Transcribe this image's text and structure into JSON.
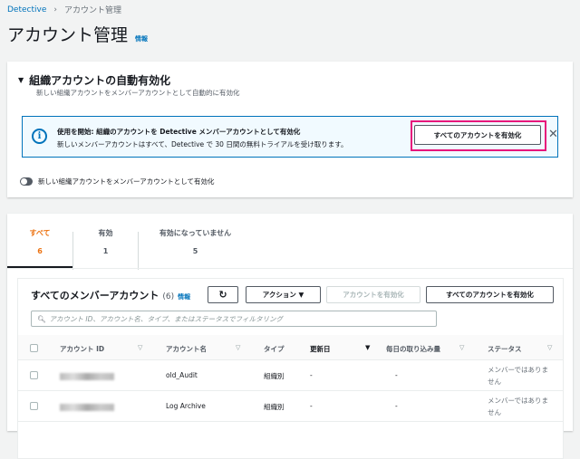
{
  "breadcrumb": {
    "root": "Detective",
    "current": "アカウント管理"
  },
  "page": {
    "title": "アカウント管理",
    "info": "情報"
  },
  "auto_enable": {
    "title": "組織アカウントの自動有効化",
    "subtitle": "新しい組織アカウントをメンバーアカウントとして自動的に有効化",
    "alert": {
      "title": "使用を開始: 組織のアカウントを Detective メンバーアカウントとして有効化",
      "body": "新しいメンバーアカウントはすべて、Detective で 30 日間の無料トライアルを受け取ります。",
      "button": "すべてのアカウントを有効化",
      "close": "✕"
    },
    "toggle_label": "新しい組織アカウントをメンバーアカウントとして有効化",
    "toggle_on": false
  },
  "tabs": [
    {
      "label": "すべて",
      "count": "6"
    },
    {
      "label": "有効",
      "count": "1"
    },
    {
      "label": "有効になっていません",
      "count": "5"
    }
  ],
  "table": {
    "title": "すべてのメンバーアカウント",
    "count": "(6)",
    "info": "情報",
    "refresh": "↻",
    "actions": "アクション ▼",
    "enable": "アカウントを有効化",
    "enable_all": "すべてのアカウントを有効化",
    "search_placeholder": "アカウント ID、アカウント名、タイプ、またはステータスでフィルタリング",
    "columns": [
      "アカウント ID",
      "アカウント名",
      "タイプ",
      "更新日",
      "毎日の取り込み量",
      "ステータス"
    ],
    "rows": [
      {
        "name": "old_Audit",
        "type": "組織別",
        "updated": "-",
        "volume": "-",
        "status": "メンバーではありません"
      },
      {
        "name": "Log Archive",
        "type": "組織別",
        "updated": "-",
        "volume": "-",
        "status": "メンバーではありません"
      }
    ]
  }
}
